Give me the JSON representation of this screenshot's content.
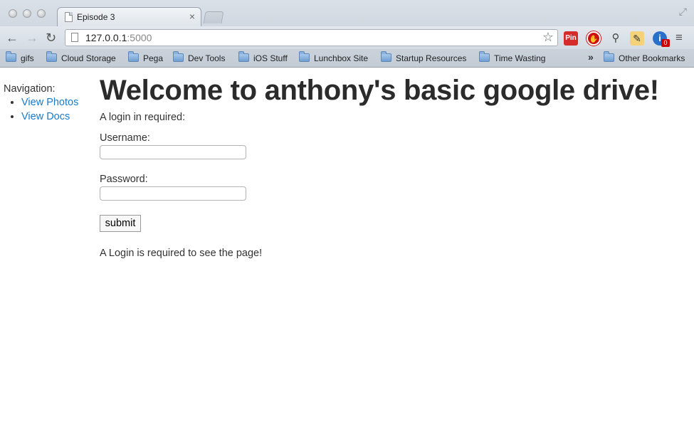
{
  "browser": {
    "tab_title": "Episode 3",
    "tab_close": "×",
    "url_host": "127.0.0.1",
    "url_port": ":5000",
    "ext_pin_label": "Pin",
    "ext_badge_count": "0"
  },
  "bookmarks": {
    "items": [
      "gifs",
      "Cloud Storage",
      "Pega",
      "Dev Tools",
      "iOS Stuff",
      "Lunchbox Site",
      "Startup Resources",
      "Time Wasting"
    ],
    "overflow": "»",
    "other": "Other Bookmarks"
  },
  "sidebar": {
    "heading": "Navigation:",
    "links": [
      "View Photos",
      "View Docs"
    ]
  },
  "main": {
    "title": "Welcome to anthony's basic google drive!",
    "login_notice": "A login in required:",
    "username_label": "Username:",
    "password_label": "Password:",
    "submit_label": "submit",
    "footer_message": "A Login is required to see the page!"
  }
}
